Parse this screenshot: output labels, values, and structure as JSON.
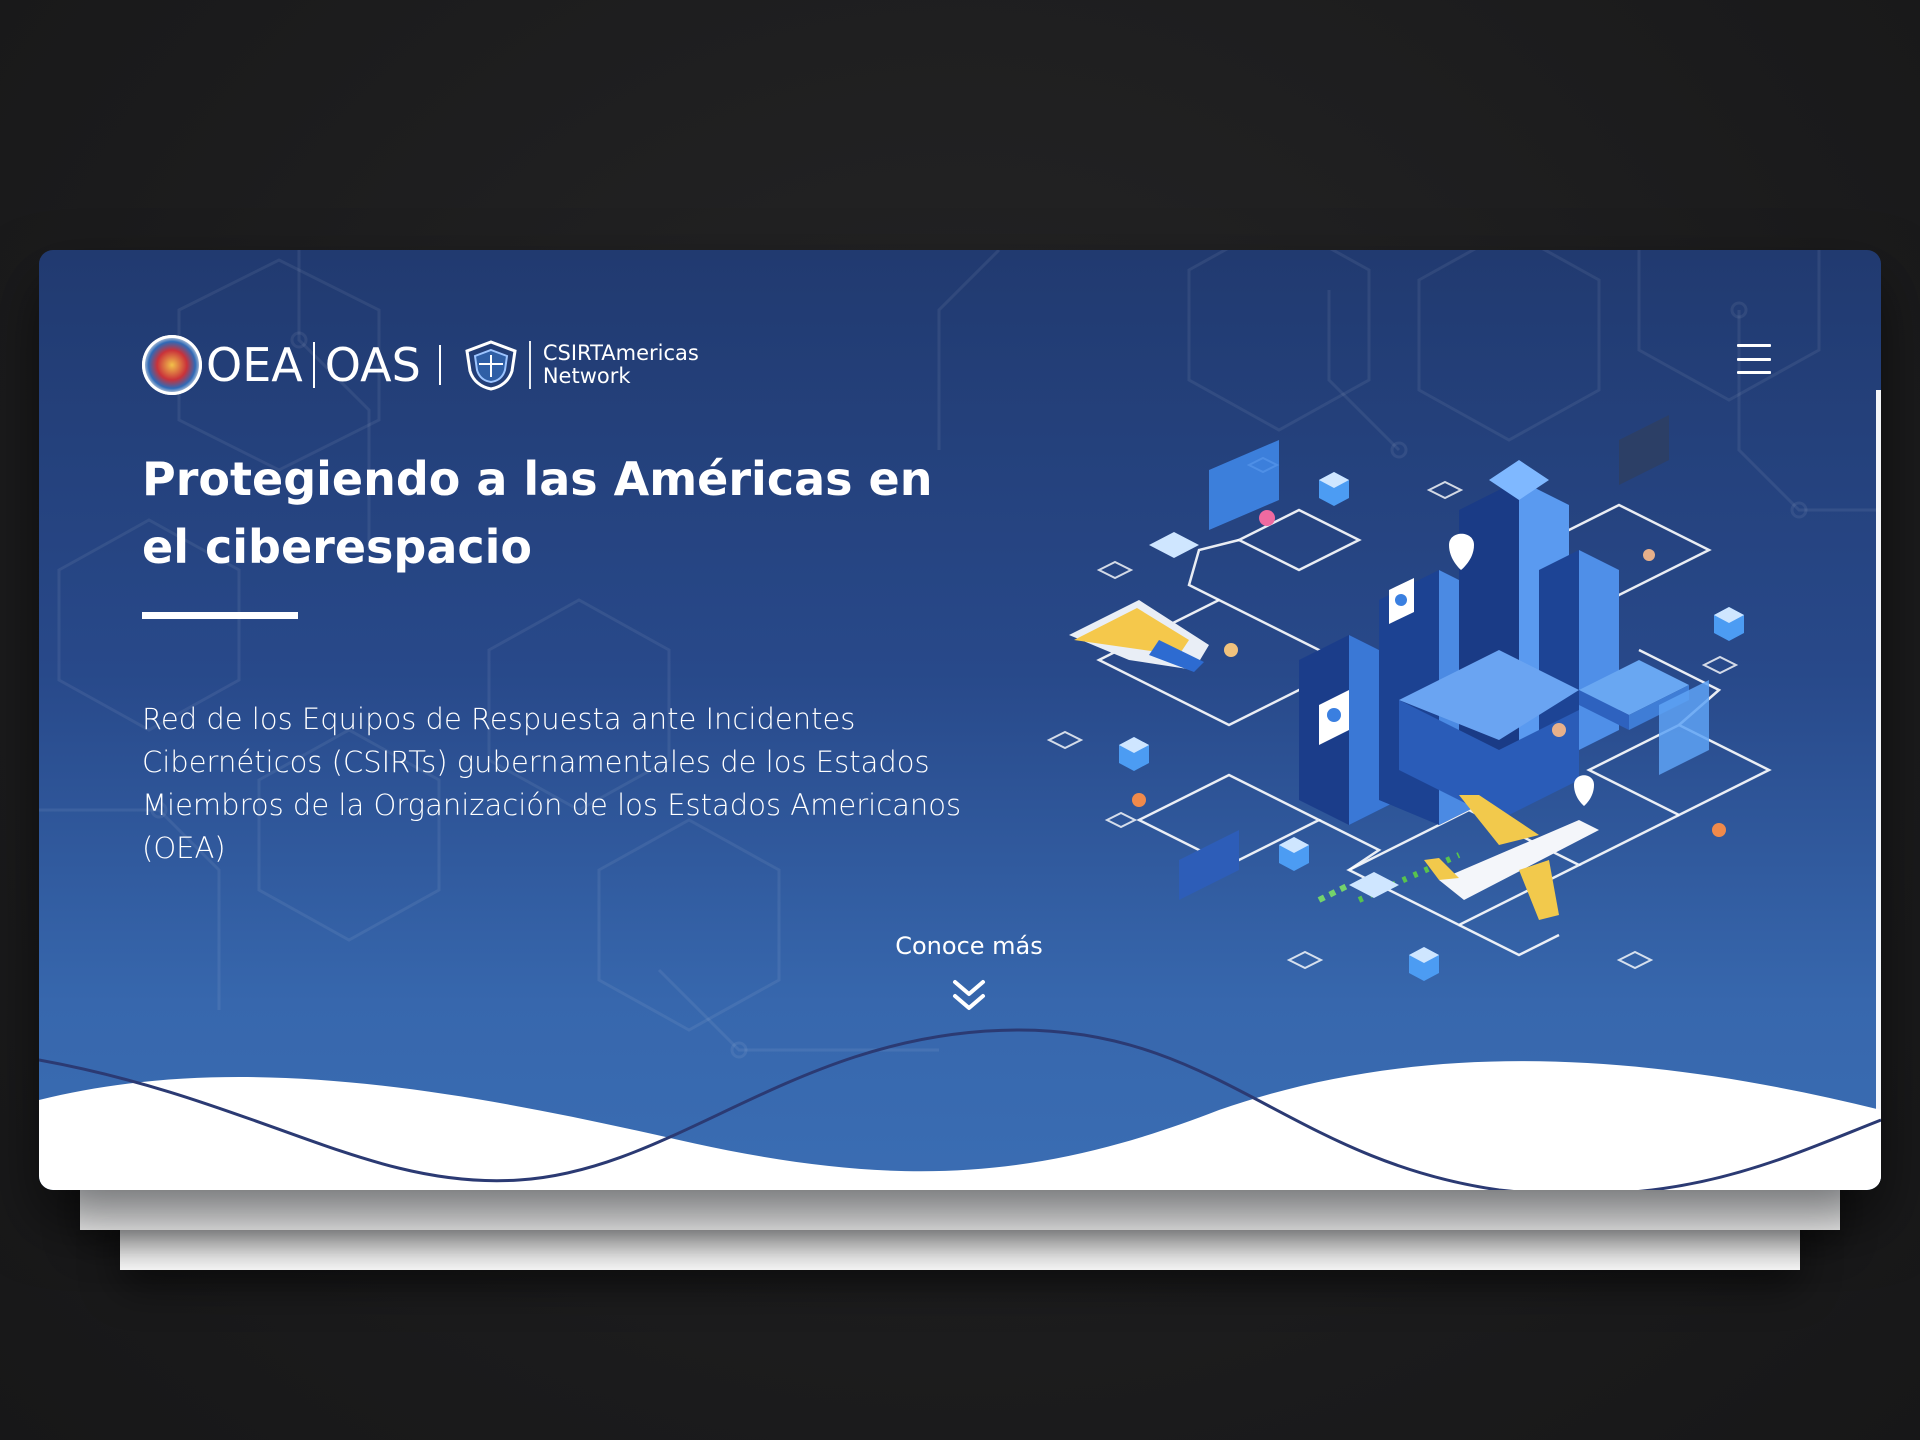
{
  "header": {
    "org_name_es": "OEA",
    "org_name_en": "OAS",
    "network_line1": "CSIRTAmericas",
    "network_line2": "Network"
  },
  "hero": {
    "title": "Protegiendo a las Américas en el ciberespacio",
    "description": "Red de los Equipos de Respuesta ante Incidentes Cibernéticos (CSIRTs) gubernamentales de los Estados Miembros de la Organización de los Estados Americanos (OEA)",
    "cta_label": "Conoce más"
  },
  "icons": {
    "menu": "hamburger-menu-icon",
    "scroll": "double-chevron-down-icon",
    "logo_seal": "oas-seal-icon",
    "logo_shield": "shield-icon"
  },
  "colors": {
    "hero_top": "#213a70",
    "hero_bottom": "#3a6db3",
    "wave_line": "#2b3a73",
    "text": "#ffffff"
  }
}
